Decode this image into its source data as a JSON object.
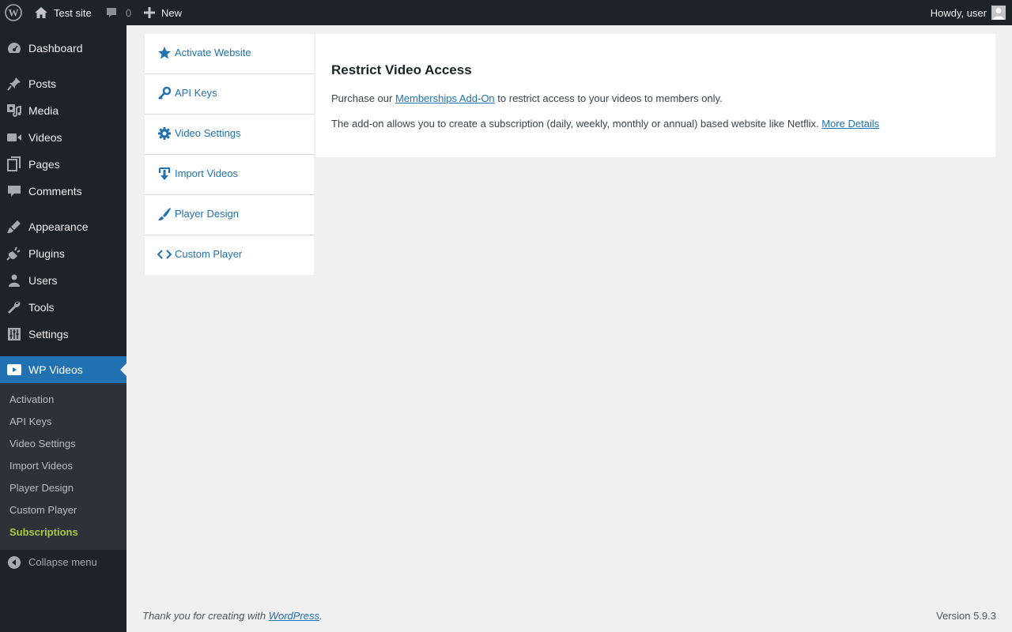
{
  "admin_bar": {
    "site_name": "Test site",
    "comments_count": "0",
    "new_label": "New",
    "howdy": "Howdy, user"
  },
  "sidebar": {
    "items": [
      {
        "label": "Dashboard",
        "icon": "dashboard-icon"
      },
      {
        "label": "Posts",
        "icon": "pin-icon"
      },
      {
        "label": "Media",
        "icon": "media-icon"
      },
      {
        "label": "Videos",
        "icon": "video-icon"
      },
      {
        "label": "Pages",
        "icon": "pages-icon"
      },
      {
        "label": "Comments",
        "icon": "comment-icon"
      },
      {
        "label": "Appearance",
        "icon": "brush-icon"
      },
      {
        "label": "Plugins",
        "icon": "plug-icon"
      },
      {
        "label": "Users",
        "icon": "user-icon"
      },
      {
        "label": "Tools",
        "icon": "wrench-icon"
      },
      {
        "label": "Settings",
        "icon": "sliders-icon"
      },
      {
        "label": "WP Videos",
        "icon": "play-icon"
      }
    ],
    "submenu": [
      "Activation",
      "API Keys",
      "Video Settings",
      "Import Videos",
      "Player Design",
      "Custom Player",
      "Subscriptions"
    ],
    "collapse_label": "Collapse menu"
  },
  "tabs": [
    {
      "label": "Activate Website",
      "icon": "star-icon"
    },
    {
      "label": "API Keys",
      "icon": "key-icon"
    },
    {
      "label": "Video Settings",
      "icon": "gear-icon"
    },
    {
      "label": "Import Videos",
      "icon": "import-icon"
    },
    {
      "label": "Player Design",
      "icon": "paintbrush-icon"
    },
    {
      "label": "Custom Player",
      "icon": "code-icon"
    }
  ],
  "panel": {
    "title": "Restrict Video Access",
    "p1_before": "Purchase our ",
    "p1_link": "Memberships Add-On",
    "p1_after": " to restrict access to your videos to members only.",
    "p2_text": "The add-on allows you to create a subscription (daily, weekly, monthly or annual) based website like Netflix. ",
    "p2_link": "More Details"
  },
  "footer": {
    "thanks_before": "Thank you for creating with ",
    "thanks_link": "WordPress",
    "thanks_after": ".",
    "version": "Version 5.9.3"
  },
  "colors": {
    "admin_bg": "#1d2327",
    "accent": "#2271b1",
    "current_sub": "#a7cc3a"
  }
}
